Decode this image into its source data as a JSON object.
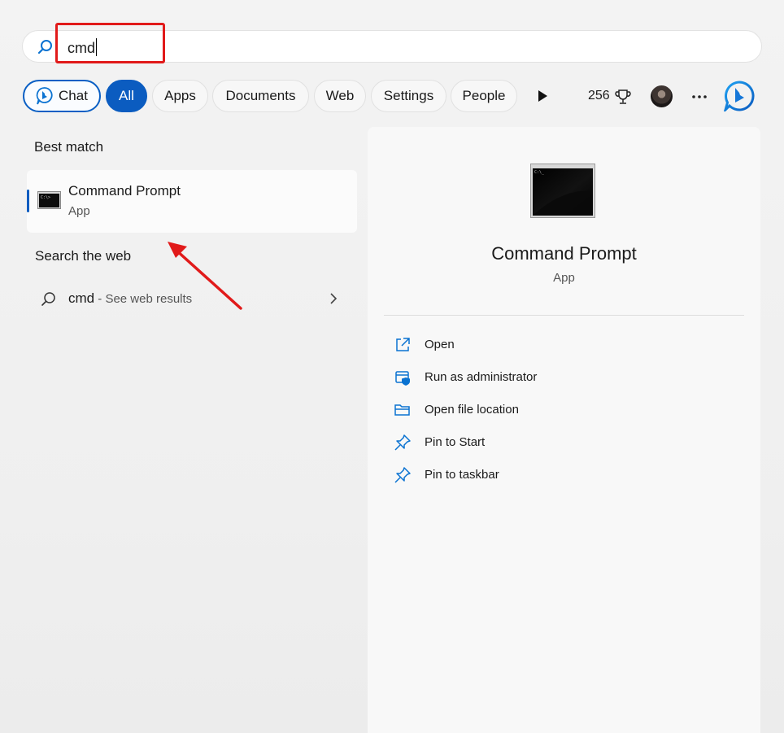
{
  "search": {
    "query": "cmd"
  },
  "filters": {
    "chat": "Chat",
    "all": "All",
    "apps": "Apps",
    "documents": "Documents",
    "web": "Web",
    "settings": "Settings",
    "people": "People"
  },
  "toolbar": {
    "points": "256"
  },
  "best_match": {
    "title": "Best match",
    "name": "Command Prompt",
    "type": "App"
  },
  "search_web": {
    "title": "Search the web",
    "query": "cmd",
    "hint": " - See web results"
  },
  "detail": {
    "name": "Command Prompt",
    "type": "App",
    "actions": [
      {
        "label": "Open",
        "icon": "open-external-icon"
      },
      {
        "label": "Run as administrator",
        "icon": "shield-admin-icon"
      },
      {
        "label": "Open file location",
        "icon": "folder-icon"
      },
      {
        "label": "Pin to Start",
        "icon": "pin-icon"
      },
      {
        "label": "Pin to taskbar",
        "icon": "pin-icon"
      }
    ]
  },
  "colors": {
    "accent": "#0b5cc0",
    "highlight": "#e11a1a"
  }
}
